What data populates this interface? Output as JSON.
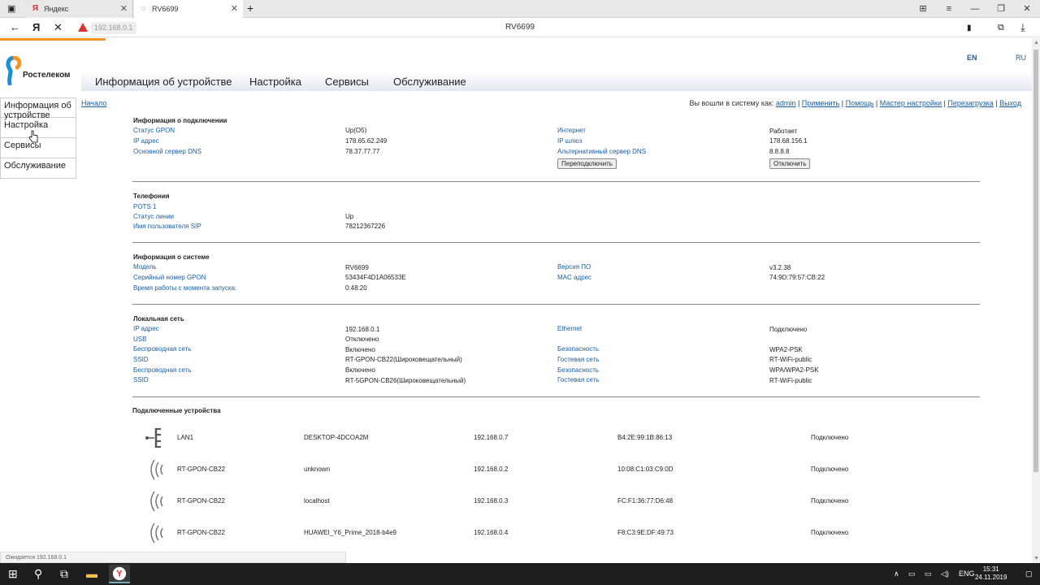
{
  "browser": {
    "tabs": [
      {
        "label": "Яндекс",
        "icon": "yandex-icon"
      },
      {
        "label": "RV6699",
        "icon": "loading-icon"
      }
    ],
    "url": "192.168.0.1",
    "page_title": "RV6699",
    "status_text": "Ожидается 192.168.0.1"
  },
  "header": {
    "brand": "Ростелеком",
    "lang_en": "EN",
    "lang_ru": "RU",
    "nav": [
      "Информация об устройстве",
      "Настройка",
      "Сервисы",
      "Обслуживание"
    ]
  },
  "sidebar": {
    "items": [
      "Информация об устройстве",
      "Настройка",
      "Сервисы",
      "Обслуживание"
    ]
  },
  "breadcrumb": "Начало",
  "usermenu": {
    "prefix": "Вы вошли в систему как:",
    "links": [
      "admin",
      "Применить",
      "Помощь",
      "Мастер настройки",
      "Перезагрузка",
      "Выход"
    ]
  },
  "connection": {
    "title": "Информация о подключении",
    "gpon_status_label": "Статус GPON",
    "gpon_status": "Up(O5)",
    "ip_label": "IP адрес",
    "ip": "178.65.62.249",
    "dns_label": "Основной сервер DNS",
    "dns": "78.37.77.77",
    "internet_label": "Интернет",
    "internet": "Работает",
    "gateway_label": "IP шлюз",
    "gateway": "178.68.156.1",
    "alt_dns_label": "Альтернативный сервер DNS",
    "alt_dns": "8.8.8.8",
    "reconnect_button": "Переподключить",
    "disconnect_button": "Отключить"
  },
  "telephony": {
    "title": "Телефония",
    "pots": "POTS 1",
    "line_status_label": "Статус линии",
    "line_status": "Up",
    "sip_user_label": "Имя пользователя SIP",
    "sip_user": "78212367226"
  },
  "system": {
    "title": "Информация о системе",
    "model_label": "Модель",
    "model": "RV6699",
    "serial_label": "Серийный номер GPON",
    "serial": "53434F4D1A06533E",
    "uptime_label": "Время работы с момента запуска:",
    "uptime": "0:48:20",
    "fw_label": "Версия ПО",
    "fw": "v3.2.38",
    "mac_label": "MAC адрес",
    "mac": "74:9D:79:57:CB:22"
  },
  "lan": {
    "title": "Локальная сеть",
    "rows_left": [
      {
        "label": "IP адрес",
        "value": "192.168.0.1"
      },
      {
        "label": "USB",
        "value": "Отключено"
      },
      {
        "label": "Беспроводная сеть",
        "value": "Включено"
      },
      {
        "label": "SSID",
        "value": "RT-GPON-CB22(Широковещательный)"
      },
      {
        "label": "Беспроводная сеть",
        "value": "Включено"
      },
      {
        "label": "SSID",
        "value": "RT-5GPON-CB26(Широковещательный)"
      }
    ],
    "rows_right": [
      {
        "label": "Ethernet",
        "value": "Подключено"
      },
      {
        "label": "Безопасность",
        "value": "WPA2-PSK"
      },
      {
        "label": "Гостевая сеть",
        "value": "RT-WiFi-public"
      },
      {
        "label": "Безопасность",
        "value": "WPA/WPA2-PSK"
      },
      {
        "label": "Гостевая сеть",
        "value": "RT-WiFi-public"
      }
    ]
  },
  "devices": {
    "title": "Подключенные устройства",
    "rows": [
      {
        "iface": "LAN1",
        "name": "DESKTOP-4DCOA2M",
        "ip": "192.168.0.7",
        "mac": "B4:2E:99:1B:86:13",
        "status": "Подключено",
        "icon": "ethernet-icon"
      },
      {
        "iface": "RT-GPON-CB22",
        "name": "unknown",
        "ip": "192.168.0.2",
        "mac": "10:08:C1:03:C9:0D",
        "status": "Подключено",
        "icon": "wifi-icon"
      },
      {
        "iface": "RT-GPON-CB22",
        "name": "localhost",
        "ip": "192.168.0.3",
        "mac": "FC:F1:36:77:D6:48",
        "status": "Подключено",
        "icon": "wifi-icon"
      },
      {
        "iface": "RT-GPON-CB22",
        "name": "HUAWEI_Y6_Prime_2018-b4e9",
        "ip": "192.168.0.4",
        "mac": "F8:C3:9E:DF:49:73",
        "status": "Подключено",
        "icon": "wifi-icon"
      }
    ]
  },
  "taskbar": {
    "lang": "ENG",
    "time": "15:31",
    "date": "24.11.2019"
  }
}
